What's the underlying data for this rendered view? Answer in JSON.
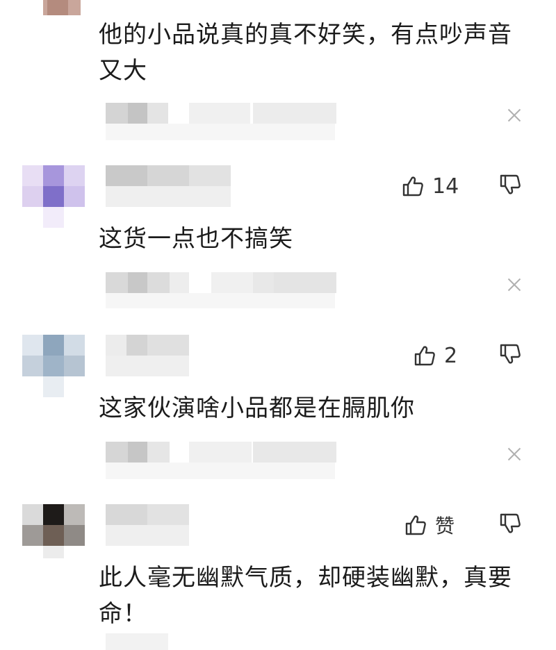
{
  "comments": [
    {
      "text": "他的小品说真的真不好笑，有点吵声音又大"
    },
    {
      "text": "这货一点也不搞笑",
      "likes": "14"
    },
    {
      "text": "这家伙演啥小品都是在膈肌你",
      "likes": "2"
    },
    {
      "text": "此人毫无幽默气质，却硬装幽默，真要命！",
      "likes": "赞"
    }
  ],
  "icons": {
    "like": "thumbs-up-icon",
    "dislike": "thumbs-down-icon",
    "close": "close-icon"
  },
  "colors": {
    "text": "#1b1b1b",
    "icon": "#333333",
    "close": "#b0b0b0",
    "blur_gray": "#e6e6e6",
    "avatar2": "#9b8ad6",
    "avatar3": "#8fa6bd",
    "avatar4": "#3a3633"
  }
}
